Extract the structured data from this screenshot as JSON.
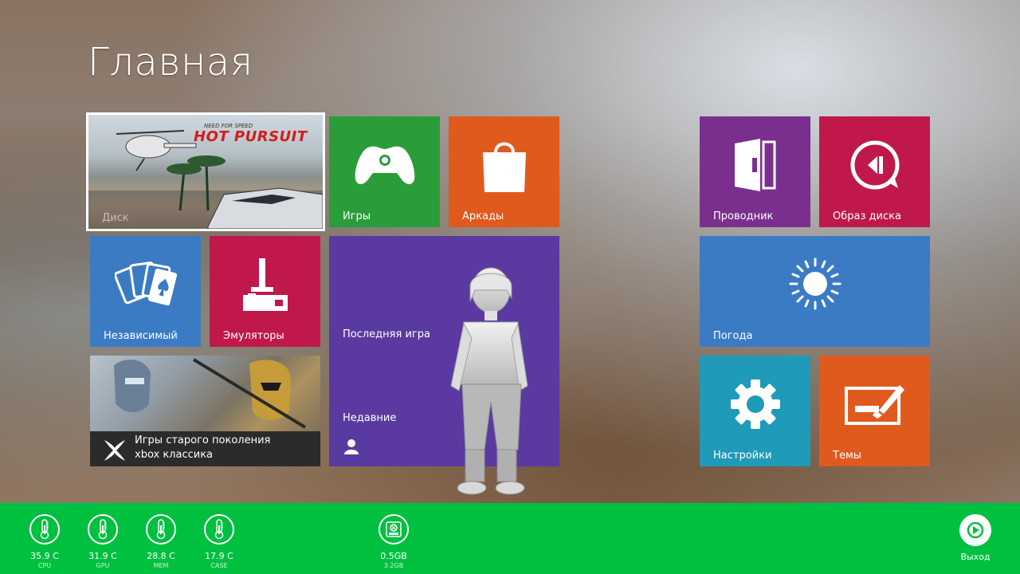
{
  "page": {
    "title": "Главная"
  },
  "colors": {
    "green": "#2a9d3a",
    "orange": "#e05a1e",
    "purple": "#7a2f8e",
    "crimson": "#c0184a",
    "blue": "#3a7bc4",
    "violet": "#5a3aa0",
    "teal": "#1f9ab8",
    "bar": "#00c040"
  },
  "tiles": {
    "featured": {
      "label": "Диск",
      "art_text": "HOT PURSUIT",
      "art_small": "NEED FOR SPEED"
    },
    "games": {
      "label": "Игры",
      "icon": "xbox-controller-icon"
    },
    "arcade": {
      "label": "Аркады",
      "icon": "shopping-bag-icon"
    },
    "explorer": {
      "label": "Проводник",
      "icon": "file-explorer-icon"
    },
    "disc_image": {
      "label": "Образ диска",
      "icon": "disc-image-icon"
    },
    "indie": {
      "label": "Независимый",
      "icon": "playing-cards-icon"
    },
    "emulators": {
      "label": "Эмуляторы",
      "icon": "joystick-icon"
    },
    "recent": {
      "label_top": "Последняя игра",
      "label_bottom": "Недавние",
      "icon": "person-icon"
    },
    "weather": {
      "label": "Погода",
      "icon": "sun-icon"
    },
    "classic": {
      "line1": "Игры старого поколения",
      "line2": "xbox классика",
      "icon": "xbox-x-icon"
    },
    "settings": {
      "label": "Настройки",
      "icon": "gear-icon"
    },
    "themes": {
      "label": "Темы",
      "icon": "paint-brush-icon"
    }
  },
  "stats": [
    {
      "value": "35.9 C",
      "label": "CPU",
      "icon": "thermometer-icon"
    },
    {
      "value": "31.9 C",
      "label": "GPU",
      "icon": "thermometer-icon"
    },
    {
      "value": "28.8 C",
      "label": "MEM",
      "icon": "thermometer-icon"
    },
    {
      "value": "17.9 C",
      "label": "CASE",
      "icon": "thermometer-icon"
    },
    {
      "value": "0.5GB",
      "label": "3.2GB",
      "icon": "hard-drive-icon"
    }
  ],
  "exit": {
    "label": "Выход",
    "icon": "exit-icon"
  }
}
